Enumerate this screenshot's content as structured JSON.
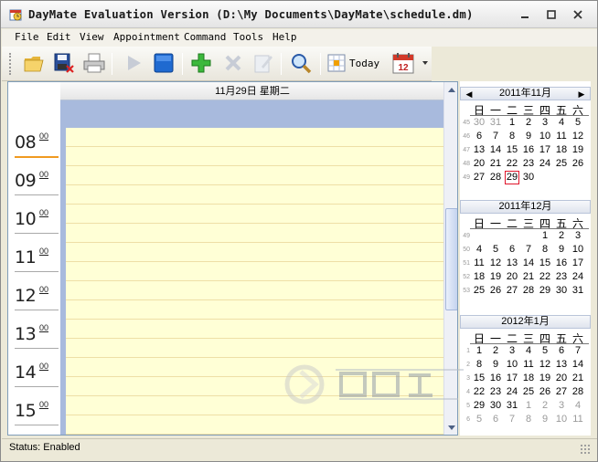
{
  "window": {
    "title": "DayMate Evaluation Version (D:\\My Documents\\DayMate\\schedule.dm)",
    "icons": {
      "app": "daymate-app-icon",
      "minimize": "minimize-icon",
      "maximize": "maximize-icon",
      "close": "close-icon"
    }
  },
  "menubar": [
    "File",
    "Edit",
    "View",
    "Appointment",
    "Command",
    "Tools",
    "Help"
  ],
  "toolbar": {
    "buttons": [
      {
        "name": "open",
        "icon": "folder-open-icon"
      },
      {
        "name": "save",
        "icon": "save-disk-icon"
      },
      {
        "name": "print",
        "icon": "printer-icon"
      },
      {
        "name": "play",
        "icon": "play-icon",
        "enabled": false
      },
      {
        "name": "stop",
        "icon": "stop-icon"
      },
      {
        "name": "add",
        "icon": "plus-icon"
      },
      {
        "name": "delete",
        "icon": "x-delete-icon",
        "enabled": false
      },
      {
        "name": "edit",
        "icon": "edit-note-icon",
        "enabled": false
      },
      {
        "name": "find",
        "icon": "magnifier-icon"
      }
    ],
    "today_label": "Today",
    "calendar_dropdown_day": "12"
  },
  "day_view": {
    "header": "11月29日 星期二",
    "hours": [
      {
        "hour": "08",
        "minutes": "00",
        "current": true
      },
      {
        "hour": "09",
        "minutes": "00"
      },
      {
        "hour": "10",
        "minutes": "00"
      },
      {
        "hour": "11",
        "minutes": "00"
      },
      {
        "hour": "12",
        "minutes": "00"
      },
      {
        "hour": "13",
        "minutes": "00"
      },
      {
        "hour": "14",
        "minutes": "00"
      },
      {
        "hour": "15",
        "minutes": "00"
      }
    ]
  },
  "calendar": {
    "weekdays": [
      "日",
      "一",
      "二",
      "三",
      "四",
      "五",
      "六"
    ],
    "months": [
      {
        "title": "2011年11月",
        "nav": true,
        "weeks": [
          {
            "wk": "45",
            "days": [
              "30",
              "31",
              "1",
              "2",
              "3",
              "4",
              "5"
            ],
            "other": [
              0,
              1
            ]
          },
          {
            "wk": "46",
            "days": [
              "6",
              "7",
              "8",
              "9",
              "10",
              "11",
              "12"
            ],
            "other": []
          },
          {
            "wk": "47",
            "days": [
              "13",
              "14",
              "15",
              "16",
              "17",
              "18",
              "19"
            ],
            "other": []
          },
          {
            "wk": "48",
            "days": [
              "20",
              "21",
              "22",
              "23",
              "24",
              "25",
              "26"
            ],
            "other": []
          },
          {
            "wk": "49",
            "days": [
              "27",
              "28",
              "29",
              "30",
              "",
              "",
              ""
            ],
            "other": [],
            "selected": 2
          }
        ]
      },
      {
        "title": "2011年12月",
        "weeks": [
          {
            "wk": "49",
            "days": [
              "",
              "",
              "",
              "",
              "1",
              "2",
              "3"
            ],
            "other": []
          },
          {
            "wk": "50",
            "days": [
              "4",
              "5",
              "6",
              "7",
              "8",
              "9",
              "10"
            ],
            "other": []
          },
          {
            "wk": "51",
            "days": [
              "11",
              "12",
              "13",
              "14",
              "15",
              "16",
              "17"
            ],
            "other": []
          },
          {
            "wk": "52",
            "days": [
              "18",
              "19",
              "20",
              "21",
              "22",
              "23",
              "24"
            ],
            "other": []
          },
          {
            "wk": "53",
            "days": [
              "25",
              "26",
              "27",
              "28",
              "29",
              "30",
              "31"
            ],
            "other": []
          }
        ]
      },
      {
        "title": "2012年1月",
        "weeks": [
          {
            "wk": "1",
            "days": [
              "1",
              "2",
              "3",
              "4",
              "5",
              "6",
              "7"
            ],
            "other": []
          },
          {
            "wk": "2",
            "days": [
              "8",
              "9",
              "10",
              "11",
              "12",
              "13",
              "14"
            ],
            "other": []
          },
          {
            "wk": "3",
            "days": [
              "15",
              "16",
              "17",
              "18",
              "19",
              "20",
              "21"
            ],
            "other": []
          },
          {
            "wk": "4",
            "days": [
              "22",
              "23",
              "24",
              "25",
              "26",
              "27",
              "28"
            ],
            "other": []
          },
          {
            "wk": "5",
            "days": [
              "29",
              "30",
              "31",
              "1",
              "2",
              "3",
              "4"
            ],
            "other": [
              3,
              4,
              5,
              6
            ]
          },
          {
            "wk": "6",
            "days": [
              "5",
              "6",
              "7",
              "8",
              "9",
              "10",
              "11"
            ],
            "other": [
              0,
              1,
              2,
              3,
              4,
              5,
              6
            ]
          }
        ]
      }
    ]
  },
  "status": {
    "text": "Status: Enabled"
  },
  "colors": {
    "selection": "#e0152b",
    "current_time": "#f09a20",
    "day_slots": "#ffffd6",
    "allday_bar": "#a8badd"
  }
}
